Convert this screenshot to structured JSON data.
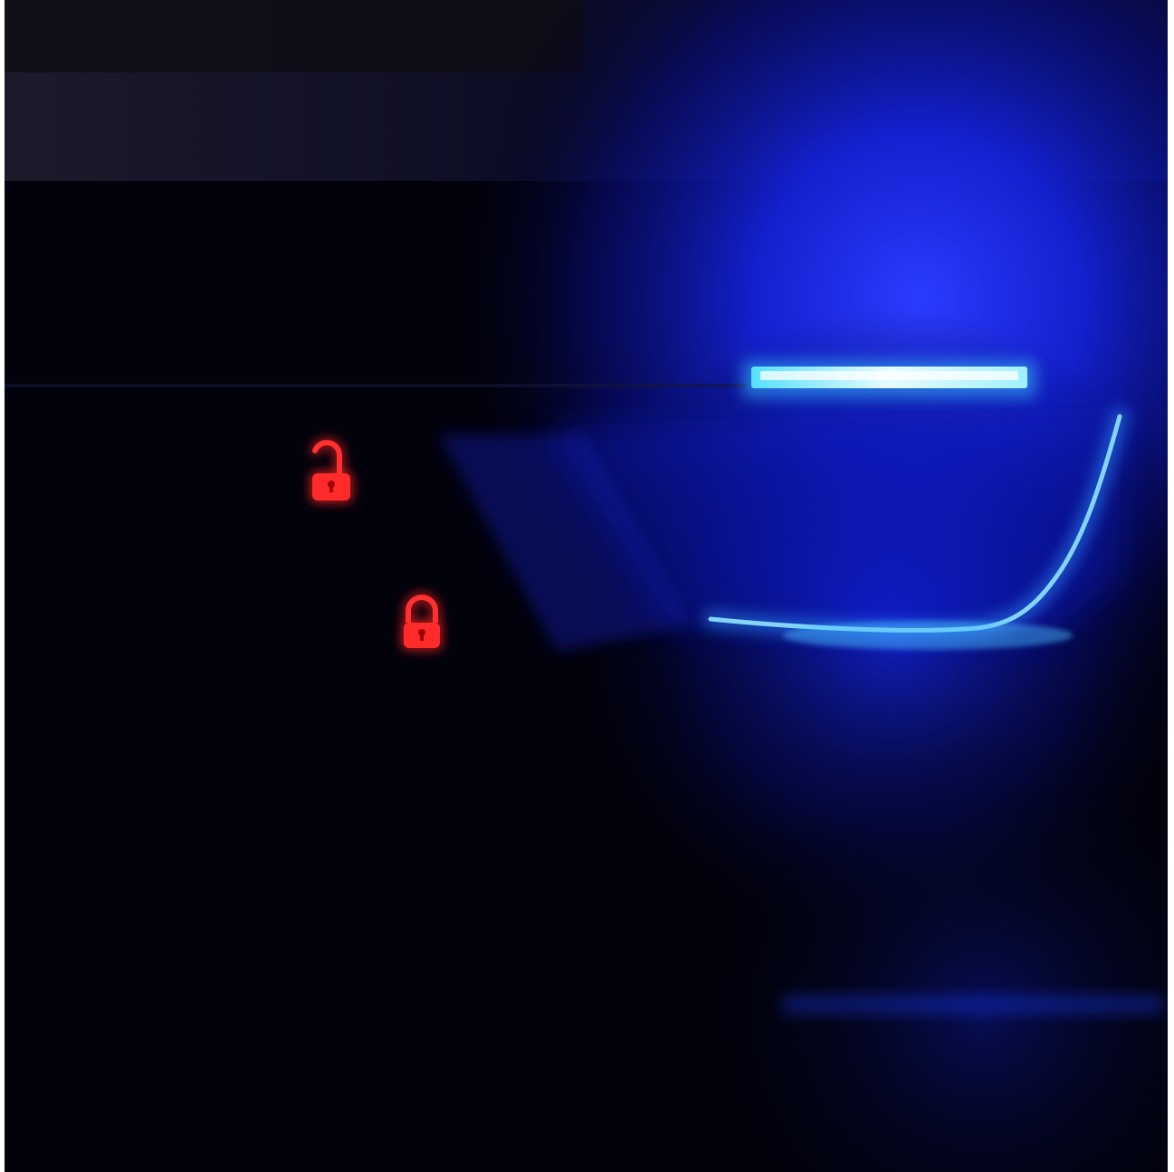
{
  "scene": {
    "subject": "car-door-interior-ambient-lighting",
    "colors": {
      "background": "#02020c",
      "ambient_blue": "#1a2cff",
      "led_strip": "#bff6ff",
      "lock_icon_red": "#ff1a1a"
    },
    "icons": [
      "unlock-icon",
      "lock-icon"
    ]
  }
}
